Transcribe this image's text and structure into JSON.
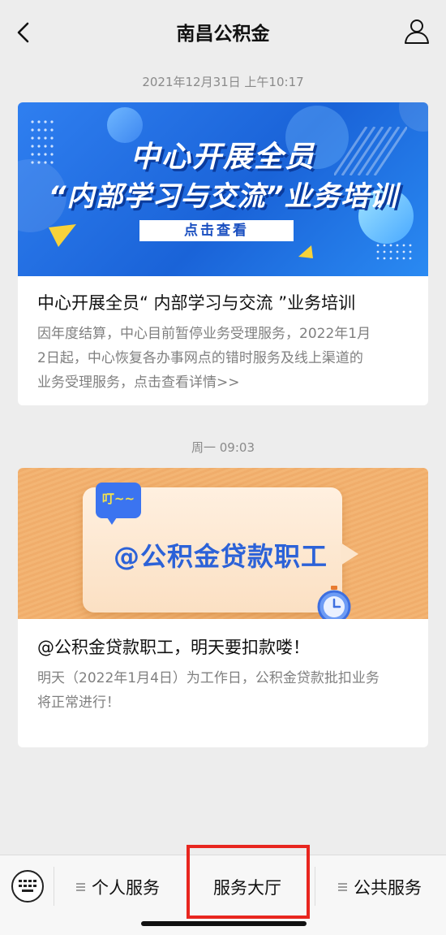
{
  "header": {
    "title": "南昌公积金",
    "back_icon": "chevron-left-icon",
    "user_icon": "user-icon"
  },
  "messages": [
    {
      "timestamp": "2021年12月31日 上午10:17",
      "banner": {
        "line1": "中心开展全员",
        "line2": "“内部学习与交流”业务培训",
        "cta": "点击查看"
      },
      "title": "中心开展全员“ 内部学习与交流 ”业务培训",
      "desc_lines": [
        "因年度结算，中心目前暂停业务受理服务，2022年1月",
        "2日起，中心恢复各办事网点的错时服务及线上渠道的",
        "业务受理服务，点击查看详情>>"
      ]
    },
    {
      "timestamp": "周一 09:03",
      "banner": {
        "bubble": "叮~~",
        "headline": "@公积金贷款职工"
      },
      "title": "@公积金贷款职工，明天要扣款喽！",
      "desc_lines": [
        "明天（2022年1月4日）为工作日，公积金贷款批扣业务",
        "将正常进行！"
      ]
    }
  ],
  "menu": {
    "keyboard_icon": "keyboard-icon",
    "items": [
      {
        "label": "个人服务",
        "has_submenu": true
      },
      {
        "label": "服务大厅",
        "has_submenu": false
      },
      {
        "label": "公共服务",
        "has_submenu": true
      }
    ],
    "highlight_color": "#e8261f"
  },
  "colors": {
    "background": "#ededed",
    "banner_blue": "#1a63d8",
    "banner_orange": "#f3b574"
  }
}
